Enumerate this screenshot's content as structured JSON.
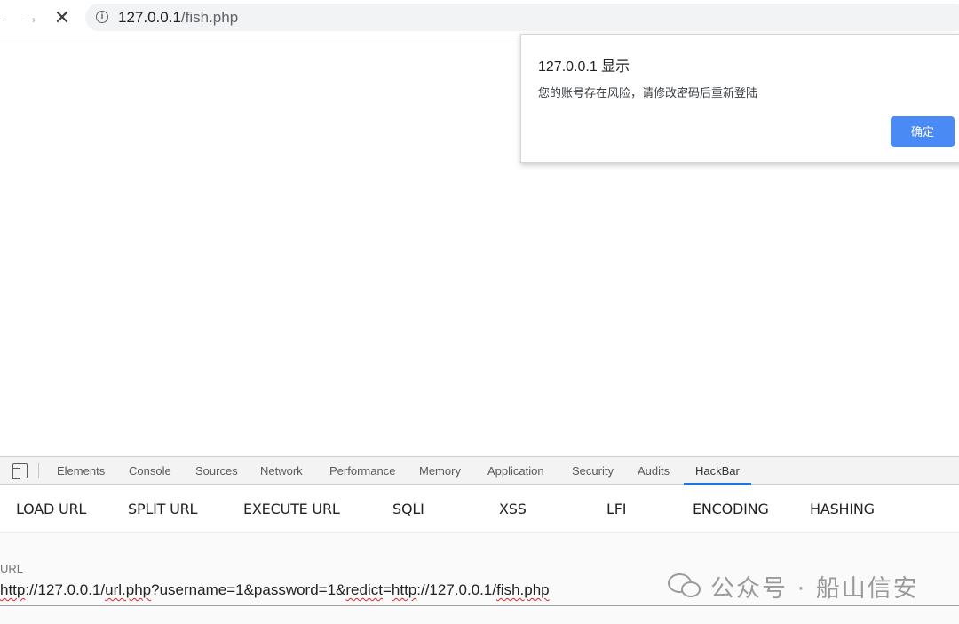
{
  "browser": {
    "back_glyph": "←",
    "forward_glyph": "→",
    "stop_glyph": "✕",
    "info_glyph": "i",
    "url_host": "127.0.0.1",
    "url_path": "/fish.php"
  },
  "dialog": {
    "title": "127.0.0.1 显示",
    "message": "您的账号存在风险，请修改密码后重新登陆",
    "ok_label": "确定",
    "ok_color": "#4a8af4"
  },
  "devtools": {
    "tabs": [
      "Elements",
      "Console",
      "Sources",
      "Network",
      "Performance",
      "Memory",
      "Application",
      "Security",
      "Audits",
      "HackBar"
    ],
    "active_tab": "HackBar",
    "accent_color": "#1a73e8"
  },
  "hackbar": {
    "menu": [
      "LOAD URL",
      "SPLIT URL",
      "EXECUTE URL",
      "SQLI",
      "XSS",
      "LFI",
      "ENCODING",
      "HASHING"
    ],
    "url_label": "URL",
    "url_value_parts": [
      "http",
      "://127.0.0.1/",
      "url.php",
      "?username=1&password=1&",
      "redict",
      "=",
      "http",
      "://127.0.0.1/",
      "fish.php"
    ]
  },
  "watermark": {
    "text": "公众号 · 船山信安"
  }
}
